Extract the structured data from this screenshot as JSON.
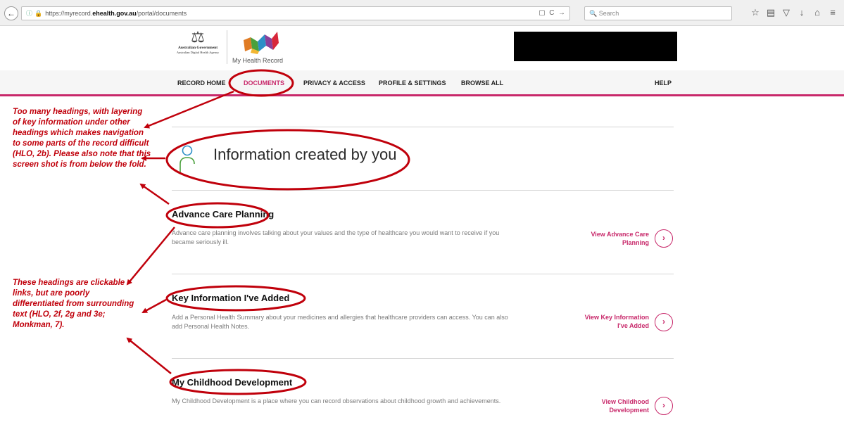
{
  "browser": {
    "url_prefix": "https://myrecord.",
    "url_host": "ehealth.gov.au",
    "url_path": "/portal/documents",
    "search_placeholder": "Search",
    "refresh_glyph": "C"
  },
  "header": {
    "gov_name": "Australian Government",
    "agency_name": "Australian Digital Health Agency",
    "product_name": "My Health Record"
  },
  "nav": {
    "items": [
      {
        "label": "RECORD HOME"
      },
      {
        "label": "DOCUMENTS",
        "active": true
      },
      {
        "label": "PRIVACY & ACCESS"
      },
      {
        "label": "PROFILE & SETTINGS"
      },
      {
        "label": "BROWSE ALL"
      }
    ],
    "help": "HELP"
  },
  "section": {
    "title": "Information created by you"
  },
  "items": [
    {
      "heading": "Advance Care Planning",
      "description": "Advance care planning involves talking about your values and the type of healthcare you would want to receive if you became seriously ill.",
      "link_line1": "View Advance Care",
      "link_line2": "Planning"
    },
    {
      "heading": "Key Information I've Added",
      "description": "Add a Personal Health Summary about your medicines and allergies that healthcare providers can access. You can also add Personal Health Notes.",
      "link_line1": "View Key Information",
      "link_line2": "I've Added"
    },
    {
      "heading": "My Childhood Development",
      "description": "My Childhood Development is a place where you can record observations about childhood growth and achievements.",
      "link_line1": "View Childhood",
      "link_line2": "Development"
    }
  ],
  "annotations": {
    "note1": "Too many headings,  with layering of key information under other headings  which makes navigation to some parts of the record difficult (HLO, 2b). Please also note that this screen shot is from below the fold.",
    "note2": "These headings are clickable links, but are poorly differentiated from surrounding text (HLO, 2f, 2g and 3e; Monkman, 7)."
  },
  "colors": {
    "brand": "#c8286a",
    "annotation": "#c0000b",
    "redaction": "#000000"
  }
}
